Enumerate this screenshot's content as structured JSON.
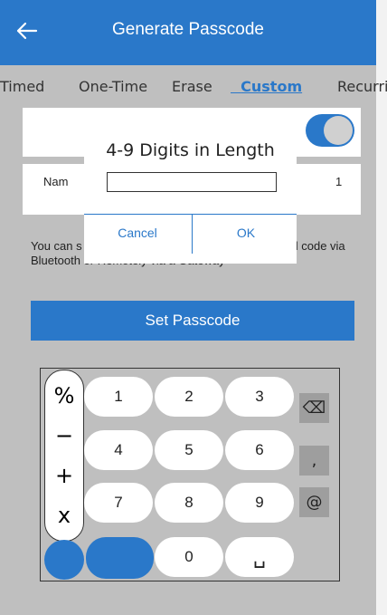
{
  "header": {
    "title": "Generate Passcode"
  },
  "tabs": [
    {
      "label": "Timed",
      "active": false
    },
    {
      "label": "One-Time",
      "active": false
    },
    {
      "label": "Erase",
      "active": false
    },
    {
      "label": "Custom",
      "active": true
    },
    {
      "label": "Recurri",
      "active": false
    }
  ],
  "form": {
    "name_label": "Nam",
    "name_count": "1",
    "toggle_on": true
  },
  "info": {
    "part1": "You can s",
    "part2": "nvl code via",
    "line2": "Bluetooth or Remotely via a Gateway"
  },
  "set_passcode_label": "Set Passcode",
  "dialog": {
    "heading": "4-9 Digits in Length",
    "input_value": "",
    "cancel_label": "Cancel",
    "ok_label": "OK"
  },
  "keypad": {
    "symbols": [
      "%",
      "−",
      "+",
      "x"
    ],
    "digits": [
      "1",
      "2",
      "3",
      "4",
      "5",
      "6",
      "7",
      "8",
      "9",
      "0"
    ],
    "space_key": "␣",
    "side_keys": [
      "⌫",
      ",",
      "@"
    ]
  },
  "colors": {
    "accent": "#2a78c9",
    "background": "#bfbfbf"
  }
}
